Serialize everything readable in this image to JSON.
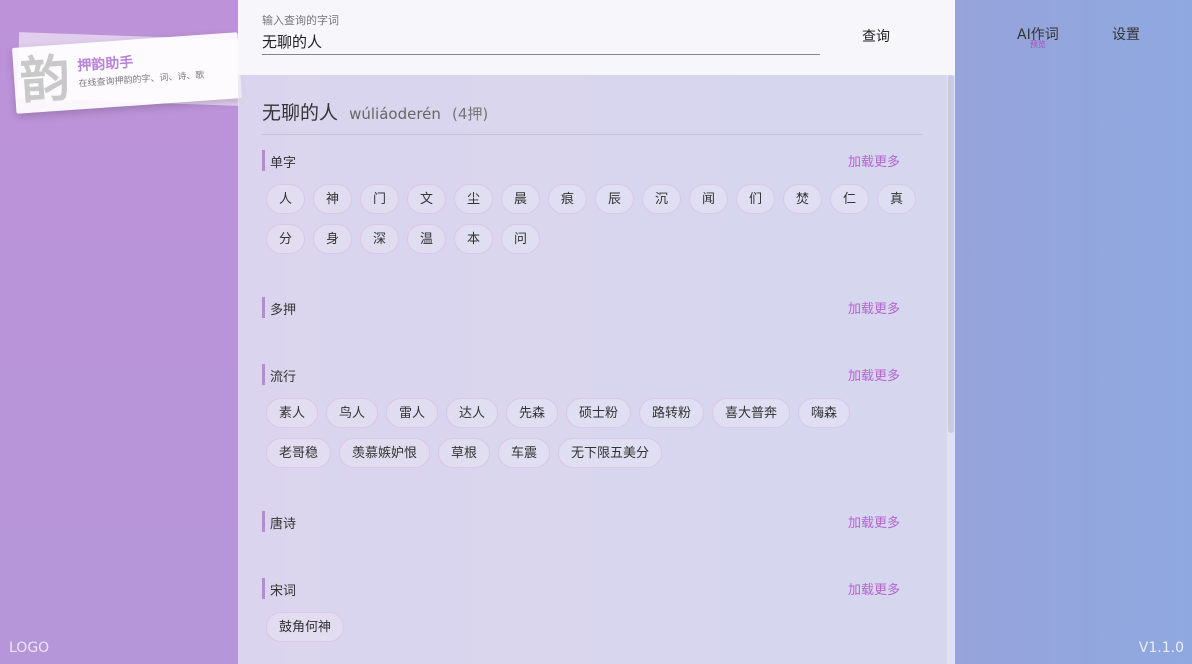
{
  "brand": {
    "glyph": "韵",
    "title": "押韵助手",
    "subtitle": "在线查询押韵的字、词、诗、歌",
    "footer": "LOGO"
  },
  "nav": {
    "ai_label": "AI作词",
    "ai_badge": "预览",
    "settings_label": "设置",
    "version": "V1.1.0"
  },
  "search": {
    "label": "输入查询的字词",
    "value": "无聊的人",
    "button": "查询"
  },
  "result": {
    "word": "无聊的人",
    "pinyin": "wúliáoderén",
    "count": "(4押)"
  },
  "sections": [
    {
      "title": "单字",
      "more": "加载更多",
      "items": [
        "人",
        "神",
        "门",
        "文",
        "尘",
        "晨",
        "痕",
        "辰",
        "沉",
        "闻",
        "们",
        "焚",
        "仁",
        "真",
        "分",
        "身",
        "深",
        "温",
        "本",
        "问"
      ]
    },
    {
      "title": "多押",
      "more": "加载更多",
      "items": []
    },
    {
      "title": "流行",
      "more": "加载更多",
      "items": [
        "素人",
        "鸟人",
        "雷人",
        "达人",
        "先森",
        "硕士粉",
        "路转粉",
        "喜大普奔",
        "嗨森",
        "老哥稳",
        "羡慕嫉妒恨",
        "草根",
        "车震",
        "无下限五美分"
      ]
    },
    {
      "title": "唐诗",
      "more": "加载更多",
      "items": []
    },
    {
      "title": "宋词",
      "more": "加载更多",
      "items": [
        "鼓角何神"
      ]
    }
  ]
}
